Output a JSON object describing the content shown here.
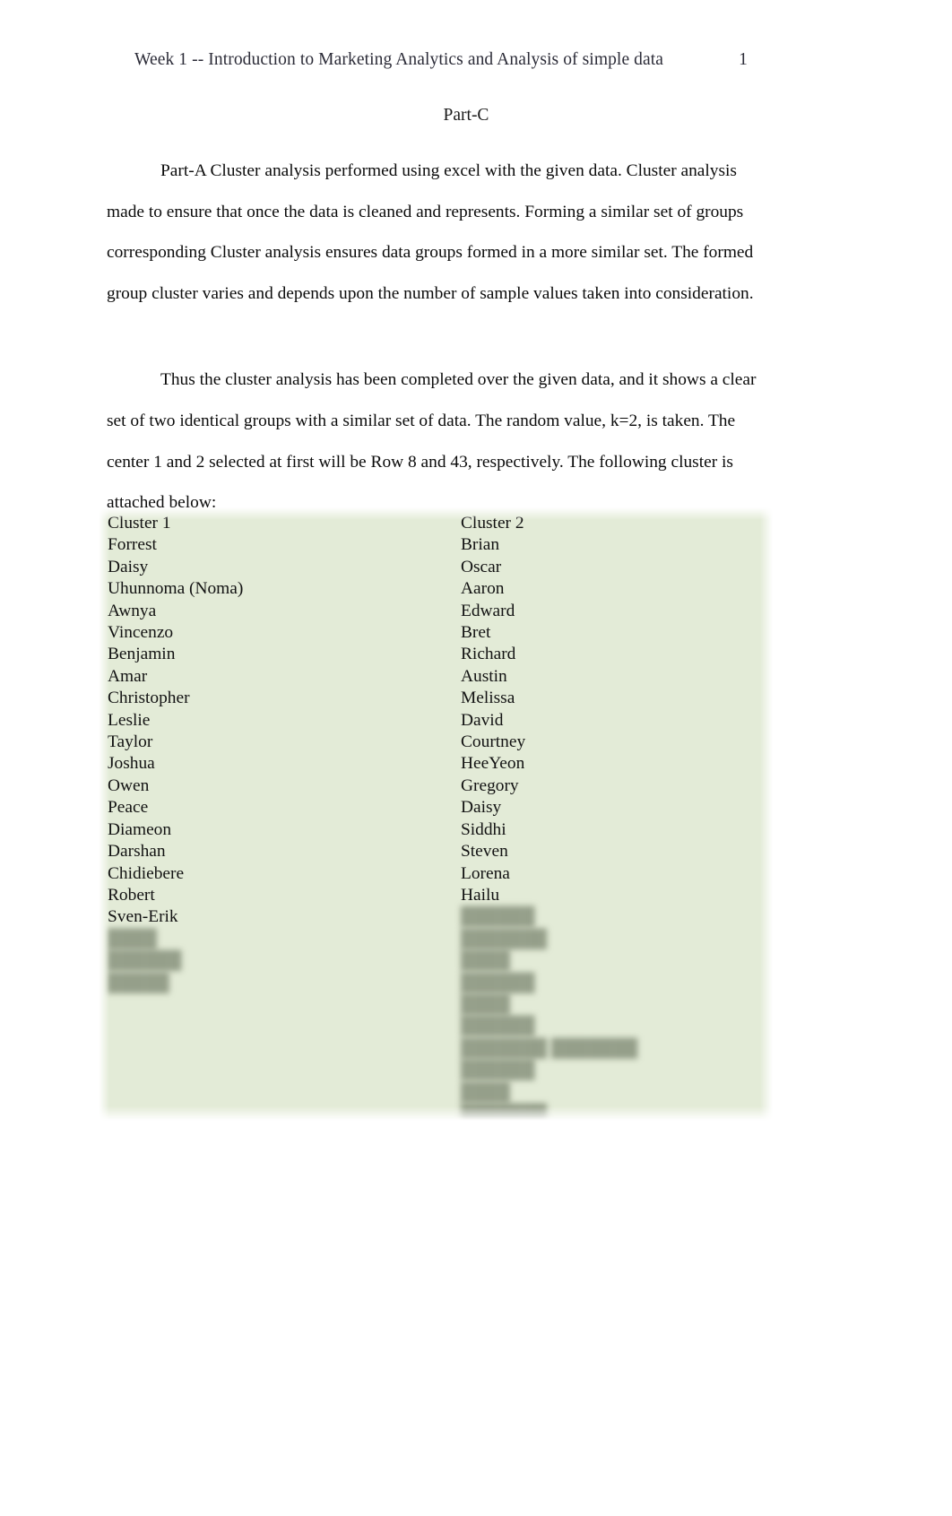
{
  "header": {
    "title": "Week 1 -- Introduction to Marketing Analytics and Analysis of simple data",
    "page_number": "1"
  },
  "document": {
    "section_title": "Part-C",
    "paragraphs": [
      "Part-A  Cluster analysis performed using excel with the given data. Cluster analysis made to ensure that once the data is cleaned and represents. Forming a similar set of groups corresponding Cluster analysis ensures data groups formed in a more similar set. The formed group cluster varies and depends upon the number of sample values taken into consideration.",
      "Thus the cluster analysis has been completed over the given data, and it shows a clear set of two identical groups with a similar set of data. The random value, k=2, is taken. The center 1 and 2 selected at first will be Row 8 and 43, respectively. The following cluster is attached below:"
    ]
  },
  "cluster_panel": {
    "background_color": "#e3ebd7",
    "columns": [
      {
        "heading": "Cluster 1",
        "names": [
          "Forrest",
          "Daisy",
          "Uhunnoma (Noma)",
          "Awnya",
          "Vincenzo",
          "Benjamin",
          "Amar",
          "Christopher",
          "Leslie",
          "Taylor",
          "Joshua",
          "Owen",
          "Peace",
          "Diameon",
          "Darshan",
          "Chidiebere",
          "Robert",
          "Sven-Erik"
        ],
        "redacted_names": [
          "████",
          "██████",
          "█████"
        ]
      },
      {
        "heading": "Cluster 2",
        "names": [
          "Brian",
          "Oscar",
          "Aaron",
          "Edward",
          "Bret",
          "Richard",
          "Austin",
          "Melissa",
          "David",
          "Courtney",
          "HeeYeon",
          "Gregory",
          "Daisy",
          "Siddhi",
          "Steven",
          "Lorena",
          "Hailu"
        ],
        "redacted_names": [
          "██████",
          "███████",
          "████",
          "██████",
          "████",
          "██████",
          "███████ ███████",
          "██████",
          "████",
          "███████"
        ]
      }
    ]
  }
}
